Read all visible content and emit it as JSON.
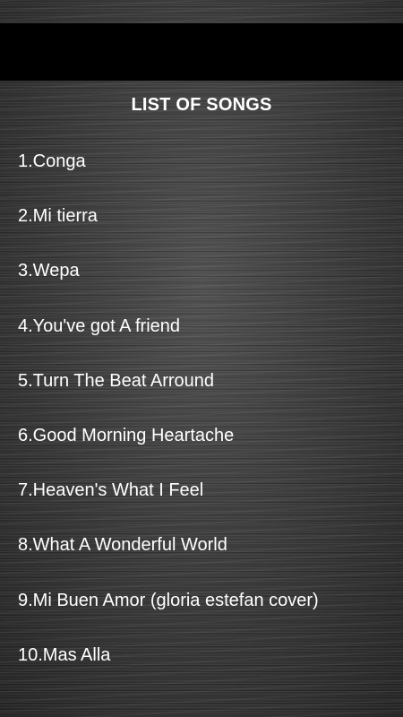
{
  "header": {
    "title": "LIST OF SONGS"
  },
  "songs": [
    {
      "label": "1.Conga"
    },
    {
      "label": "2.Mi tierra"
    },
    {
      "label": "3.Wepa"
    },
    {
      "label": "4.You've got A friend"
    },
    {
      "label": "5.Turn The Beat Arround"
    },
    {
      "label": "6.Good Morning Heartache"
    },
    {
      "label": "7.Heaven's What I Feel"
    },
    {
      "label": "8.What A Wonderful World"
    },
    {
      "label": "9.Mi Buen Amor (gloria estefan cover)"
    },
    {
      "label": "10.Mas Alla"
    }
  ],
  "colors": {
    "top_bar": "#000000",
    "text": "#ffffff",
    "background": "#3a3a3a"
  }
}
